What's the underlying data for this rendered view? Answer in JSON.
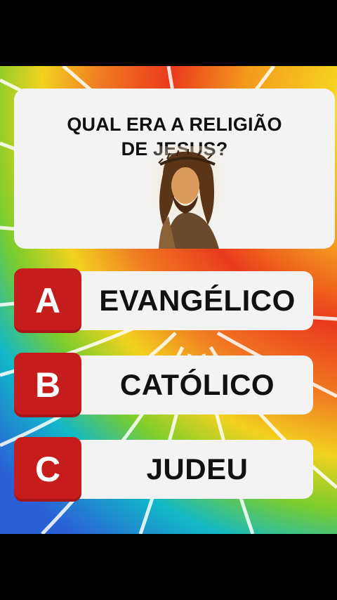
{
  "quiz": {
    "question_line1": "QUAL ERA A RELIGIÃO",
    "question_line2": "DE JESUS?",
    "image": "jesus-portrait",
    "options": [
      {
        "letter": "A",
        "text": "EVANGÉLICO"
      },
      {
        "letter": "B",
        "text": "CATÓLICO"
      },
      {
        "letter": "C",
        "text": "JUDEU"
      }
    ]
  },
  "colors": {
    "letter_badge": "#c61c1c",
    "card": "#f3f3f3",
    "text": "#111111",
    "rainbow": [
      "#e8321e",
      "#f47a1f",
      "#f6c41d",
      "#9bd22a",
      "#22b8a0",
      "#1fa0e0",
      "#2563d8"
    ]
  }
}
